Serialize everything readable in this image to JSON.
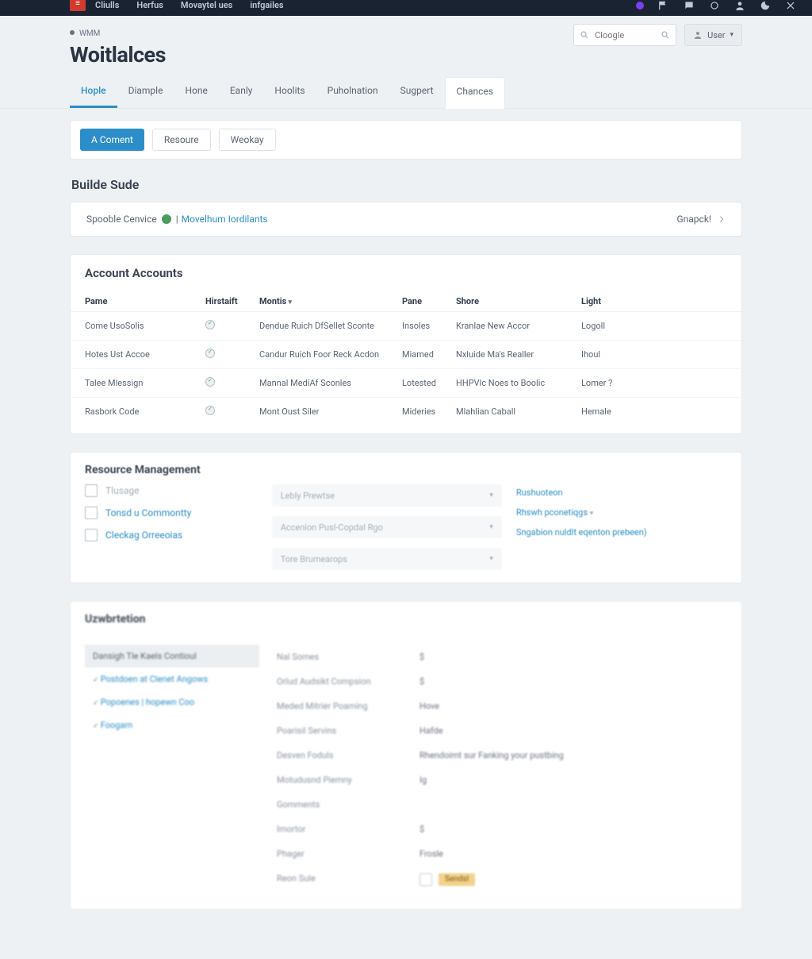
{
  "topnav": {
    "items": [
      "Cliulls",
      "Herfus",
      "Movaytel ues",
      "infgailes"
    ],
    "logo_text": "≡"
  },
  "header": {
    "crumb": "WMM",
    "title": "Woitlalces",
    "search_placeholder": "Cloogle",
    "user_label": "User"
  },
  "tabs": [
    {
      "label": "Hople",
      "active": true
    },
    {
      "label": "Diample"
    },
    {
      "label": "Hone"
    },
    {
      "label": "Eanly"
    },
    {
      "label": "Hoolits"
    },
    {
      "label": "Puholnation"
    },
    {
      "label": "Sugpert"
    },
    {
      "label": "Chances",
      "raised": true
    }
  ],
  "action_buttons": {
    "primary": "A Coment",
    "ghost1": "Resoure",
    "ghost2": "Weokay"
  },
  "section1_title": "Builde Sude",
  "strip": {
    "label": "Spooble Cenvice",
    "link_sep": "|",
    "link": "Movelhum Iordilants",
    "right_label": "Gnapck!"
  },
  "accounts": {
    "title": "Account Accounts",
    "columns": [
      "Pame",
      "Hirstaift",
      "Montis",
      "Pane",
      "Shore",
      "Light"
    ],
    "rows": [
      {
        "c0": "Come UsoSolis",
        "c2": "Dendue Ruich DfSellet Sconte",
        "c3": "Insoles",
        "c4": "Kranlae New Accor",
        "c5": "Logoll"
      },
      {
        "c0": "Hotes Ust Accoe",
        "c2": "Candur Ruich Foor Reck Acdon",
        "c3": "Miamed",
        "c4": "Nxluide Ma's Realler",
        "c5": "Ihoul"
      },
      {
        "c0": "Talee Mlessign",
        "c2": "Mannal MediAf Sconles",
        "c3": "Lotested",
        "c4": "HHPVlc Noes to Boolic",
        "c5": "Lomer ?"
      },
      {
        "c0": "Rasbork Code",
        "c2": "Mont Oust Siler",
        "c3": "Mideries",
        "c4": "Mlahlian Caball",
        "c5": "Hemale"
      }
    ]
  },
  "resource": {
    "title": "Resource Management",
    "checks": [
      {
        "label": "Tlusage",
        "link": false
      },
      {
        "label": "Tonsd u Commontty",
        "link": true
      },
      {
        "label": "Cleckag Orreeoias",
        "link": true
      }
    ],
    "selects": [
      "Lebly Prewtse",
      "Accenion Pusl-Copdal Rgo",
      "Tore Brumearops"
    ],
    "links": [
      "Rushuoteon",
      "Rhswh pconetiqgs",
      "Sngabion nuldlt eqenton prebeen)"
    ]
  },
  "uz": {
    "title": "Uzwbrtetion",
    "side": [
      {
        "label": "Dansigh Tle Kaels Contioul",
        "sel": true
      },
      {
        "label": "Postdoen at Clenet Angows",
        "sel": false
      },
      {
        "label": "Popoenes | hopewn Coo",
        "sel": false
      },
      {
        "label": "Foogarn",
        "sel": false
      }
    ],
    "kv": [
      {
        "k": "Nal Somes",
        "v": "$"
      },
      {
        "k": "Orlud Audsikt Compsion",
        "v": "$"
      },
      {
        "k": "Meded Mitrier Poaming",
        "v": "Hove"
      },
      {
        "k": "Poarisil Servins",
        "v": "Hafde"
      },
      {
        "k": "Desven Foduls",
        "v": "Rhendoimt sur Fanking your pustbing"
      },
      {
        "k": "Motudusnd Piemny",
        "v": "Ig"
      },
      {
        "k": "Gomments",
        "v": ""
      },
      {
        "k": "Imortor",
        "v": "$"
      },
      {
        "k": "Phager",
        "v": "Frosle"
      },
      {
        "k": "Reon Sule",
        "v": "",
        "chip": "Sendsl",
        "box": true
      }
    ]
  }
}
